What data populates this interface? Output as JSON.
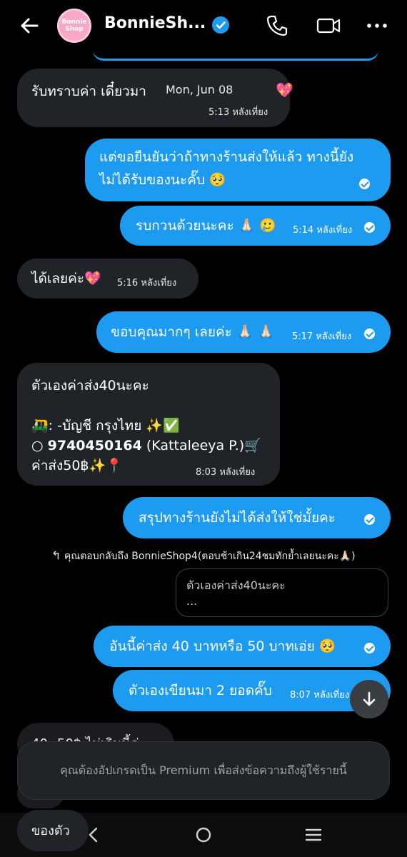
{
  "header": {
    "title": "BonnieSh...",
    "avatar_text": "Bonnie Shop"
  },
  "date_separator": "Mon, Jun 08",
  "messages": [
    {
      "dir": "in",
      "text": "รับทราบค่า เดี๋ยวมา",
      "emoji": "💖",
      "time": "5:13 หลังเที่ยง"
    },
    {
      "dir": "out",
      "line1": "แต่ขอยืนยันว่าถ้าทางร้านส่งให้แล้ว ทางนี้ยัง",
      "line2": "ไม่ได้รับของนะคั๊บ 🥺"
    },
    {
      "dir": "out",
      "text": "รบกวนด้วยนะคะ 🙏🏻 🥲",
      "time": "5:14 หลังเที่ยง"
    },
    {
      "dir": "in",
      "text": "ได้เลยค่ะ💖",
      "time": "5:16 หลังเที่ยง"
    },
    {
      "dir": "out",
      "text": "ขอบคุณมากๆ เลยค่ะ 🙏🏻 🙏🏻",
      "time": "5:17 หลังเที่ยง"
    },
    {
      "dir": "in",
      "line1": "ตัวเองค่าส่ง40นะคะ",
      "line2": "🛺: -บัญชี กรุงไทย ✨✅",
      "line3_bullet": "○",
      "line3_account": "9740450164",
      "line3_rest": "(Kattaleeya P.)🛒",
      "line4": "ค่าส่ง50฿✨📍",
      "time": "8:03 หลังเที่ยง"
    },
    {
      "dir": "out",
      "text": "สรุปทางร้านยังไม่ได้ส่งให้ใช่มั้ยคะ"
    },
    {
      "dir": "out",
      "text": "อันนี้ค่าส่ง 40 บาทหรือ 50 บาทเอ่ย 🥺"
    },
    {
      "dir": "out",
      "text": "ตัวเองเขียนมา 2 ยอดคั๊บ",
      "time": "8:07 หลังเที่ยง"
    },
    {
      "dir": "in",
      "text": "40--50฿ ไม่เกินนี้ค่ะ"
    },
    {
      "dir": "in",
      "text": "ของตัว"
    }
  ],
  "reply": {
    "meta": "คุณตอบกลับถึง BonnieShop4(ตอบช้าเกิน24ชมทักย้ำเลยนะคะ🙏🏻)",
    "quote_line1": "ตัวเองค่าส่ง40นะคะ",
    "quote_line2": "..."
  },
  "premium_notice": "คุณต้องอัปเกรดเป็น Premium เพื่อส่งข้อความถึงผู้ใช้รายนี้",
  "colors": {
    "accent": "#1d9bf0",
    "incoming": "#202327",
    "background": "#000000"
  }
}
